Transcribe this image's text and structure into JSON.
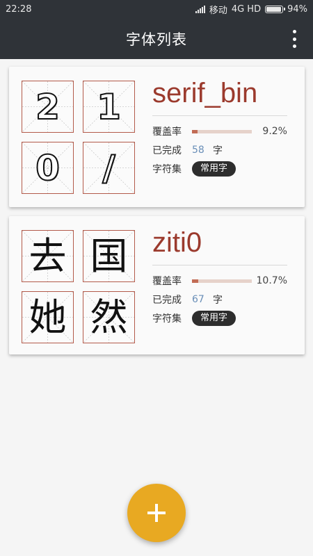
{
  "status_bar": {
    "time": "22:28",
    "carrier": "移动",
    "network": "4G HD",
    "battery": "94%",
    "battery_level": 0.94
  },
  "app_bar": {
    "title": "字体列表",
    "menu_icon": "more-vert-icon"
  },
  "labels": {
    "coverage": "覆盖率",
    "completed": "已完成",
    "char_unit": "字",
    "charset": "字符集"
  },
  "fonts": [
    {
      "name": "serif_bin",
      "glyphs": [
        "2",
        "1",
        "0",
        "/"
      ],
      "coverage_pct": "9.2%",
      "coverage": 0.092,
      "completed": "58",
      "charset": "常用字"
    },
    {
      "name": "ziti0",
      "glyphs": [
        "去",
        "国",
        "她",
        "然"
      ],
      "coverage_pct": "10.7%",
      "coverage": 0.107,
      "completed": "67",
      "charset": "常用字"
    }
  ],
  "fab": {
    "icon": "add-icon"
  },
  "colors": {
    "app_bar": "#2f3338",
    "accent": "#e8a922",
    "font_name": "#9b3a2d",
    "grid_border": "#b35a4a"
  }
}
